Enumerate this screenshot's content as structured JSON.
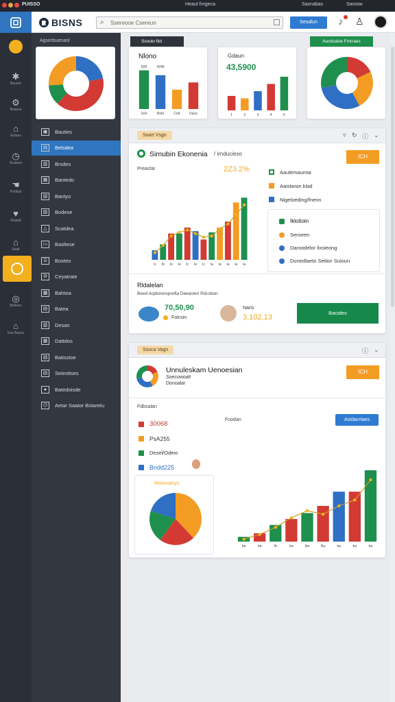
{
  "topbar": {
    "title": "PUISSO",
    "center": "Heaut fnrgeca",
    "right": [
      "Sasnabas",
      "Saroow"
    ]
  },
  "appbar": {
    "logo": "BISNS",
    "search_placeholder": "Ssereooe Csereun",
    "action_label": "Sesafun"
  },
  "rail": {
    "items": [
      {
        "icon": "puzzle-icon",
        "label": "Bsuroo"
      },
      {
        "icon": "gear-icon",
        "label": "Beauss"
      },
      {
        "icon": "house-icon",
        "label": "Eotues"
      },
      {
        "icon": "clock-icon",
        "label": "Sruaess"
      },
      {
        "icon": "hand-icon",
        "label": "Prrtitsst"
      },
      {
        "icon": "heart-icon",
        "label": "Riuladl"
      },
      {
        "icon": "home-icon",
        "label": "Sealt"
      },
      {
        "icon": "circle-icon",
        "label": "Botraos"
      },
      {
        "icon": "cap-icon",
        "label": "Eas Buess"
      }
    ]
  },
  "nav": {
    "header": "Agsedsuesasl",
    "items": [
      "Bauties",
      "Belsdea",
      "Brsdes",
      "Bantedo",
      "Bantyo",
      "Bodese",
      "Scatdea",
      "Basltese",
      "Bosteo",
      "Ceyatrate",
      "Bahtoa",
      "Batea",
      "Desan",
      "Dattdos",
      "Batisstoe",
      "Seiesttses",
      "Batedoisde",
      "Aetar Saator Bstaretu"
    ]
  },
  "colors": {
    "green": "#1f8f4d",
    "blue": "#2f6fc4",
    "orange": "#f39c23",
    "red": "#d23a33",
    "rail": "#2b2f38",
    "nav": "#33373f",
    "accent": "#f2b01e"
  },
  "summary": {
    "pie1": {
      "title": "",
      "slices": [
        {
          "value": 22,
          "color": "#2f6fc4"
        },
        {
          "value": 40,
          "color": "#d23a33"
        },
        {
          "value": 12,
          "color": "#1f8f4d"
        },
        {
          "value": 26,
          "color": "#f39c23"
        }
      ]
    },
    "tab_label": "Ssoulo fiid",
    "bar1": {
      "title": "Nlono",
      "value_labels": [
        "828",
        "4248",
        "",
        ""
      ],
      "categories": [
        "Sori",
        "Bold",
        "Cotr",
        "Daos"
      ]
    },
    "bar2": {
      "title": "Gdaun",
      "big_value": "43,5900",
      "categories": [
        "",
        "",
        "",
        "",
        ""
      ]
    },
    "legend_title": "Aucticalse Fmrraes",
    "pie2": {
      "title": ""
    }
  },
  "panel1": {
    "tag": "Soart Vsgn",
    "title": "Simubin Ekonenia",
    "subtitle": "/ irnducieso",
    "highlight": "2Z3.2%",
    "button": "ICH",
    "chart_label": "Preasfar",
    "legend": [
      "Aaulemaumia",
      "Aaistwsin klad",
      "Nigeloeding/fnenn"
    ],
    "list_title": "Iklotioin",
    "list": [
      "Seroeen",
      "Daroodelor lixsieong",
      "Dunedlaeto Seitior Suioun"
    ],
    "footer_title": "Rldalelan",
    "footer_sub": "Beed Aqdisionsprefia  Deeasleri Rdcsbon",
    "stat1_value": "70,50,90",
    "stat1_label": "Folcsin",
    "stat2_label": "Naris",
    "stat2_value": "3,102,13",
    "green_button": "Bacides"
  },
  "panel2": {
    "tag": "Ssoca Vagn",
    "title": "Unnuleskam Uenoesian",
    "subtitle1": "Soecowoalt",
    "subtitle2": "Donoalar",
    "button": "ICH",
    "section_label": "Fdbsalan",
    "stats": [
      {
        "value": "30068",
        "color": "#d23a33"
      },
      {
        "value": "PsA255",
        "color": "#f39c23"
      },
      {
        "value": "Desel/Odeio",
        "color": "#1f8f4d"
      },
      {
        "value": "Bndd225",
        "color": "#2f6fc4"
      }
    ],
    "pie_title": "Reitonaisyn",
    "chart_label": "Fnodan",
    "blue_button": "Astdacrtaes"
  },
  "chart_data": [
    {
      "type": "bar",
      "title": "Nlono",
      "categories": [
        "Sori",
        "Bold",
        "Cotr",
        "Daos"
      ],
      "values": [
        80,
        70,
        40,
        55
      ],
      "colors": [
        "#1f8f4d",
        "#2f6fc4",
        "#f39c23",
        "#d23a33"
      ]
    },
    {
      "type": "bar",
      "title": "Gdaun",
      "categories": [
        "1",
        "2",
        "3",
        "4",
        "5"
      ],
      "values": [
        30,
        25,
        40,
        55,
        70
      ],
      "colors": [
        "#d23a33",
        "#f39c23",
        "#2f6fc4",
        "#d23a33",
        "#1f8f4d"
      ]
    },
    {
      "type": "bar",
      "title": "",
      "xlabel": "",
      "ylabel": "",
      "ylim": [
        0,
        700
      ],
      "yticks": [
        50,
        150,
        300,
        500,
        700
      ],
      "categories": [
        "Ic",
        "Ib",
        "Io",
        "Ie",
        "Ic",
        "Ie",
        "Ic",
        "Ia",
        "Ia",
        "Ia",
        "Ia",
        "Ia"
      ],
      "values": [
        80,
        130,
        220,
        220,
        270,
        240,
        170,
        230,
        270,
        320,
        480,
        520
      ],
      "overlay": [
        60,
        120,
        200,
        230,
        250,
        220,
        190,
        200,
        260,
        300,
        380,
        460
      ],
      "colors": [
        "#2f6fc4",
        "#1f8f4d",
        "#d23a33",
        "#1f8f4d",
        "#d23a33",
        "#2f6fc4",
        "#d23a33",
        "#1f8f4d",
        "#f39c23",
        "#d23a33",
        "#f39c23",
        "#1f8f4d"
      ]
    },
    {
      "type": "bar",
      "title": "",
      "xlabel": "",
      "ylabel": "",
      "ylim": [
        0,
        900
      ],
      "yticks": [
        0,
        250,
        300,
        500,
        700
      ],
      "categories": [
        "ba",
        "ba",
        "Ib",
        "ba",
        "Ibe",
        "Ba",
        "ba",
        "ba",
        "ba"
      ],
      "values": [
        40,
        70,
        140,
        190,
        240,
        300,
        420,
        420,
        600
      ],
      "overlay": [
        20,
        60,
        120,
        200,
        260,
        230,
        300,
        350,
        520
      ],
      "colors": [
        "#1f8f4d",
        "#d23a33",
        "#1f8f4d",
        "#d23a33",
        "#1f8f4d",
        "#d23a33",
        "#2f6fc4",
        "#d23a33",
        "#1f8f4d"
      ]
    },
    {
      "type": "pie",
      "title": "",
      "values": [
        38,
        22,
        20,
        20
      ],
      "colors": [
        "#f39c23",
        "#d23a33",
        "#1f8f4d",
        "#2f6fc4"
      ]
    },
    {
      "type": "pie",
      "title": "",
      "values": [
        18,
        24,
        30,
        28
      ],
      "colors": [
        "#d23a33",
        "#f39c23",
        "#2f6fc4",
        "#1f8f4d"
      ]
    }
  ]
}
